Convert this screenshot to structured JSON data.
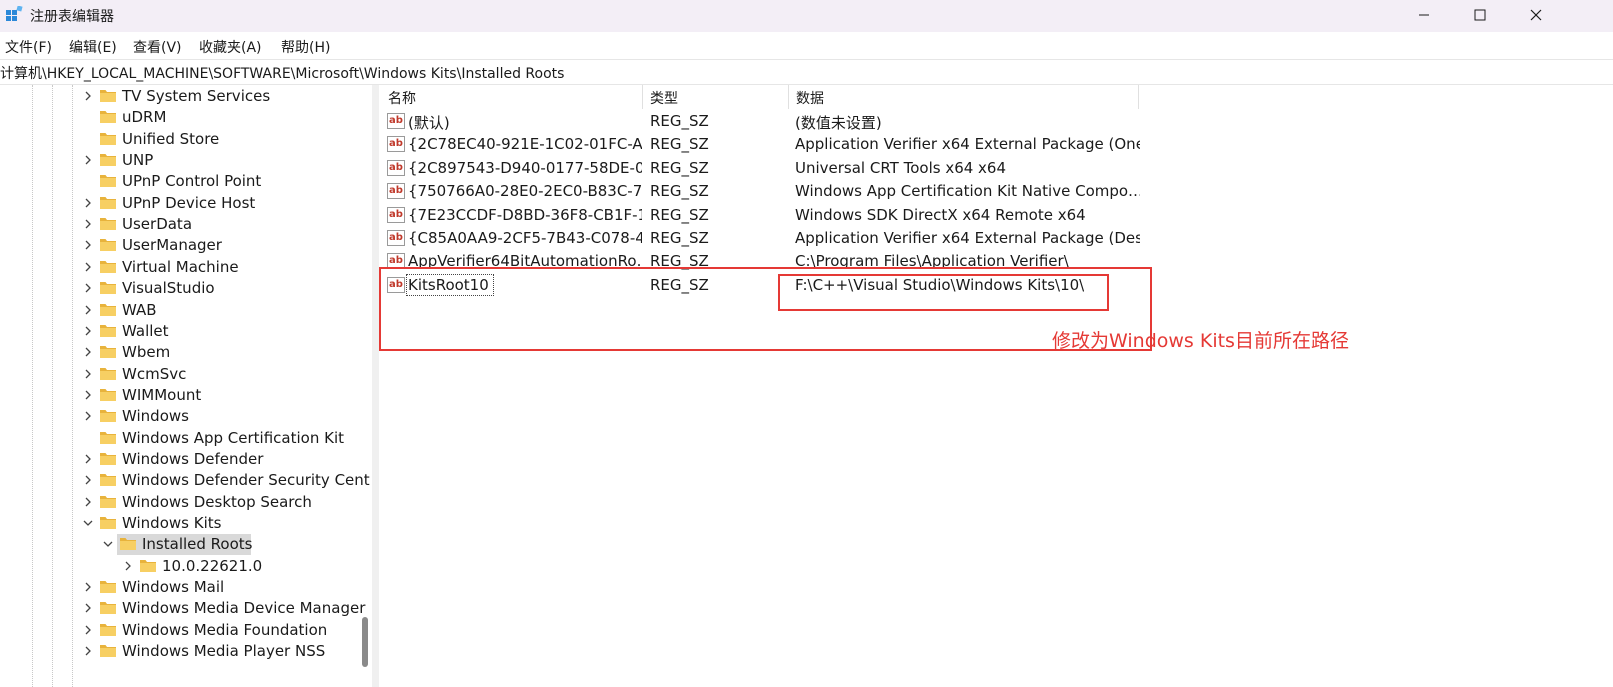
{
  "window": {
    "title": "注册表编辑器",
    "icon": "regedit-icon"
  },
  "menu": [
    "文件(F)",
    "编辑(E)",
    "查看(V)",
    "收藏夹(A)",
    "帮助(H)"
  ],
  "address": "计算机\\HKEY_LOCAL_MACHINE\\SOFTWARE\\Microsoft\\Windows Kits\\Installed Roots",
  "tree": [
    {
      "label": "TV System Services",
      "depth": 0,
      "expander": "collapsed"
    },
    {
      "label": "uDRM",
      "depth": 0,
      "expander": "none"
    },
    {
      "label": "Unified Store",
      "depth": 0,
      "expander": "none"
    },
    {
      "label": "UNP",
      "depth": 0,
      "expander": "collapsed"
    },
    {
      "label": "UPnP Control Point",
      "depth": 0,
      "expander": "none"
    },
    {
      "label": "UPnP Device Host",
      "depth": 0,
      "expander": "collapsed"
    },
    {
      "label": "UserData",
      "depth": 0,
      "expander": "collapsed"
    },
    {
      "label": "UserManager",
      "depth": 0,
      "expander": "collapsed"
    },
    {
      "label": "Virtual Machine",
      "depth": 0,
      "expander": "collapsed"
    },
    {
      "label": "VisualStudio",
      "depth": 0,
      "expander": "collapsed"
    },
    {
      "label": "WAB",
      "depth": 0,
      "expander": "collapsed"
    },
    {
      "label": "Wallet",
      "depth": 0,
      "expander": "collapsed"
    },
    {
      "label": "Wbem",
      "depth": 0,
      "expander": "collapsed"
    },
    {
      "label": "WcmSvc",
      "depth": 0,
      "expander": "collapsed"
    },
    {
      "label": "WIMMount",
      "depth": 0,
      "expander": "collapsed"
    },
    {
      "label": "Windows",
      "depth": 0,
      "expander": "collapsed"
    },
    {
      "label": "Windows App Certification Kit",
      "depth": 0,
      "expander": "none"
    },
    {
      "label": "Windows Defender",
      "depth": 0,
      "expander": "collapsed"
    },
    {
      "label": "Windows Defender Security Cent",
      "depth": 0,
      "expander": "collapsed"
    },
    {
      "label": "Windows Desktop Search",
      "depth": 0,
      "expander": "collapsed"
    },
    {
      "label": "Windows Kits",
      "depth": 0,
      "expander": "expanded"
    },
    {
      "label": "Installed Roots",
      "depth": 1,
      "expander": "expanded",
      "selected": true
    },
    {
      "label": "10.0.22621.0",
      "depth": 2,
      "expander": "collapsed"
    },
    {
      "label": "Windows Mail",
      "depth": 0,
      "expander": "collapsed"
    },
    {
      "label": "Windows Media Device Manager",
      "depth": 0,
      "expander": "collapsed"
    },
    {
      "label": "Windows Media Foundation",
      "depth": 0,
      "expander": "collapsed"
    },
    {
      "label": "Windows Media Player NSS",
      "depth": 0,
      "expander": "collapsed"
    }
  ],
  "columns": [
    "名称",
    "类型",
    "数据"
  ],
  "values": [
    {
      "name": "(默认)",
      "type": "REG_SZ",
      "data": "(数值未设置)"
    },
    {
      "name": "{2C78EC40-921E-1C02-01FC-A…",
      "type": "REG_SZ",
      "data": "Application Verifier x64 External Package (One…"
    },
    {
      "name": "{2C897543-D940-0177-58DE-0…",
      "type": "REG_SZ",
      "data": "Universal CRT Tools x64 x64"
    },
    {
      "name": "{750766A0-28E0-2EC0-B83C-7…",
      "type": "REG_SZ",
      "data": "Windows App Certification Kit Native Compo…"
    },
    {
      "name": "{7E23CCDF-D8BD-36F8-CB1F-1…",
      "type": "REG_SZ",
      "data": "Windows SDK DirectX x64 Remote x64"
    },
    {
      "name": "{C85A0AA9-2CF5-7B43-C078-4…",
      "type": "REG_SZ",
      "data": "Application Verifier x64 External Package (Des…"
    },
    {
      "name": "AppVerifier64BitAutomationRo…",
      "type": "REG_SZ",
      "data": "C:\\Program Files\\Application Verifier\\"
    },
    {
      "name": "KitsRoot10",
      "type": "REG_SZ",
      "data": "F:\\C++\\Visual Studio\\Windows Kits\\10\\",
      "focused": true
    }
  ],
  "annotation": "修改为Windows Kits目前所在路径",
  "colors": {
    "annotation_red": "#e53935",
    "folder_yellow": "#f2c55c",
    "selection_gray": "#d9d9d9"
  },
  "icons": {
    "value_type": "string-value-icon",
    "tree_node": "folder-icon"
  }
}
